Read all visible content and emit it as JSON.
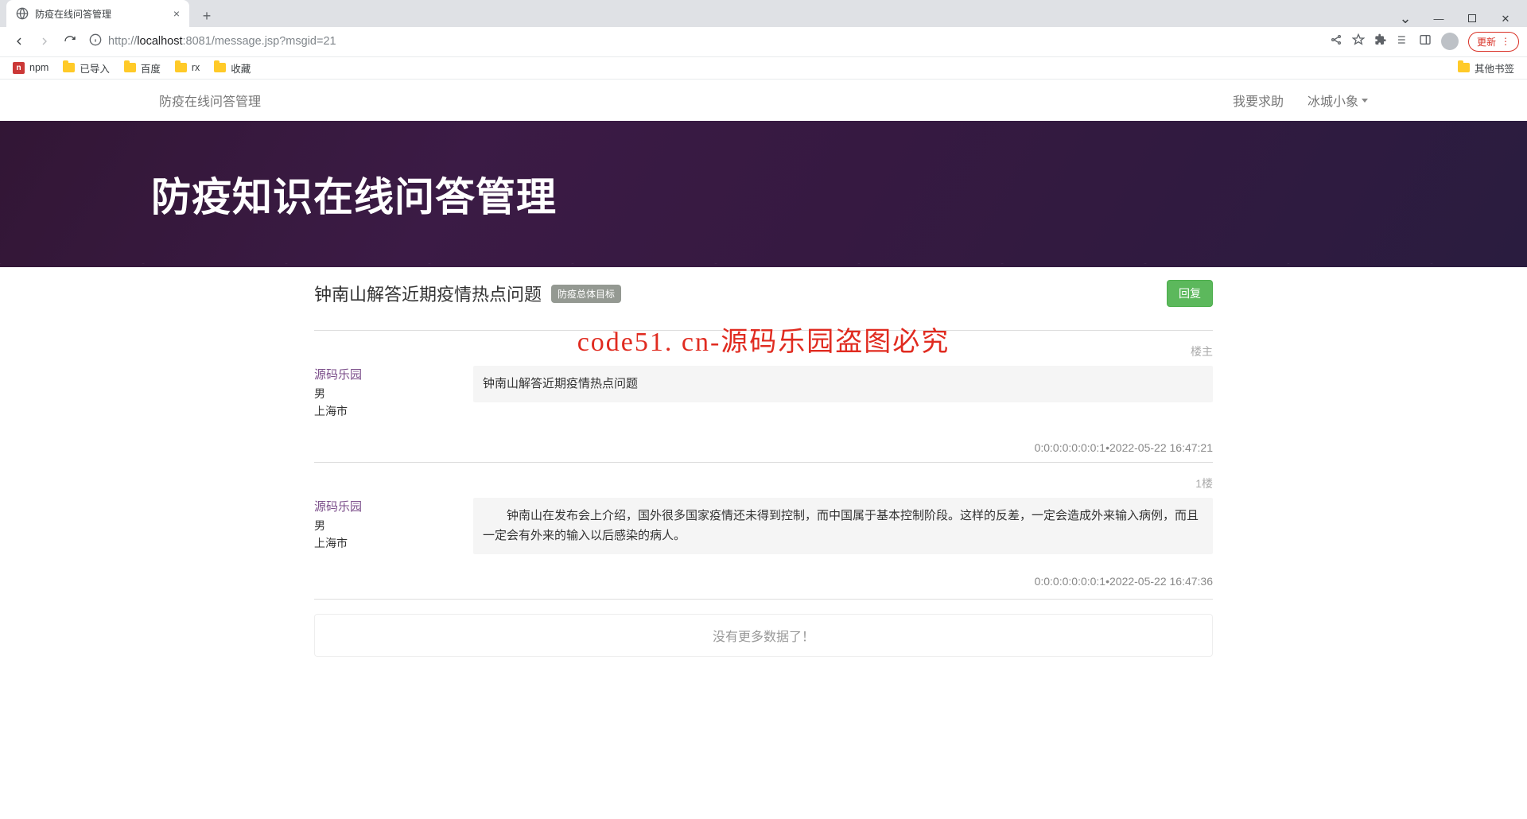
{
  "browser": {
    "tab_title": "防疫在线问答管理",
    "url_prefix": "http://",
    "url_host": "localhost",
    "url_port": ":8081",
    "url_path": "/message.jsp?msgid=21",
    "update_label": "更新",
    "bookmarks": {
      "npm": "npm",
      "imported": "已导入",
      "baidu": "百度",
      "rx": "rx",
      "favorites": "收藏",
      "other": "其他书签"
    }
  },
  "nav": {
    "title": "防疫在线问答管理",
    "help_link": "我要求助",
    "user_name": "冰城小象"
  },
  "hero": {
    "title": "防疫知识在线问答管理"
  },
  "thread": {
    "title": "钟南山解答近期疫情热点问题",
    "tag": "防疫总体目标",
    "reply_button": "回复"
  },
  "watermark": "code51. cn-源码乐园盗图必究",
  "posts": [
    {
      "floor": "楼主",
      "author_name": "源码乐园",
      "author_gender": "男",
      "author_city": "上海市",
      "content": "钟南山解答近期疫情热点问题",
      "meta": "0:0:0:0:0:0:0:1•2022-05-22 16:47:21"
    },
    {
      "floor": "1楼",
      "author_name": "源码乐园",
      "author_gender": "男",
      "author_city": "上海市",
      "content": "钟南山在发布会上介绍，国外很多国家疫情还未得到控制，而中国属于基本控制阶段。这样的反差，一定会造成外来输入病例，而且一定会有外来的输入以后感染的病人。",
      "meta": "0:0:0:0:0:0:0:1•2022-05-22 16:47:36"
    }
  ],
  "nomore": "没有更多数据了！"
}
